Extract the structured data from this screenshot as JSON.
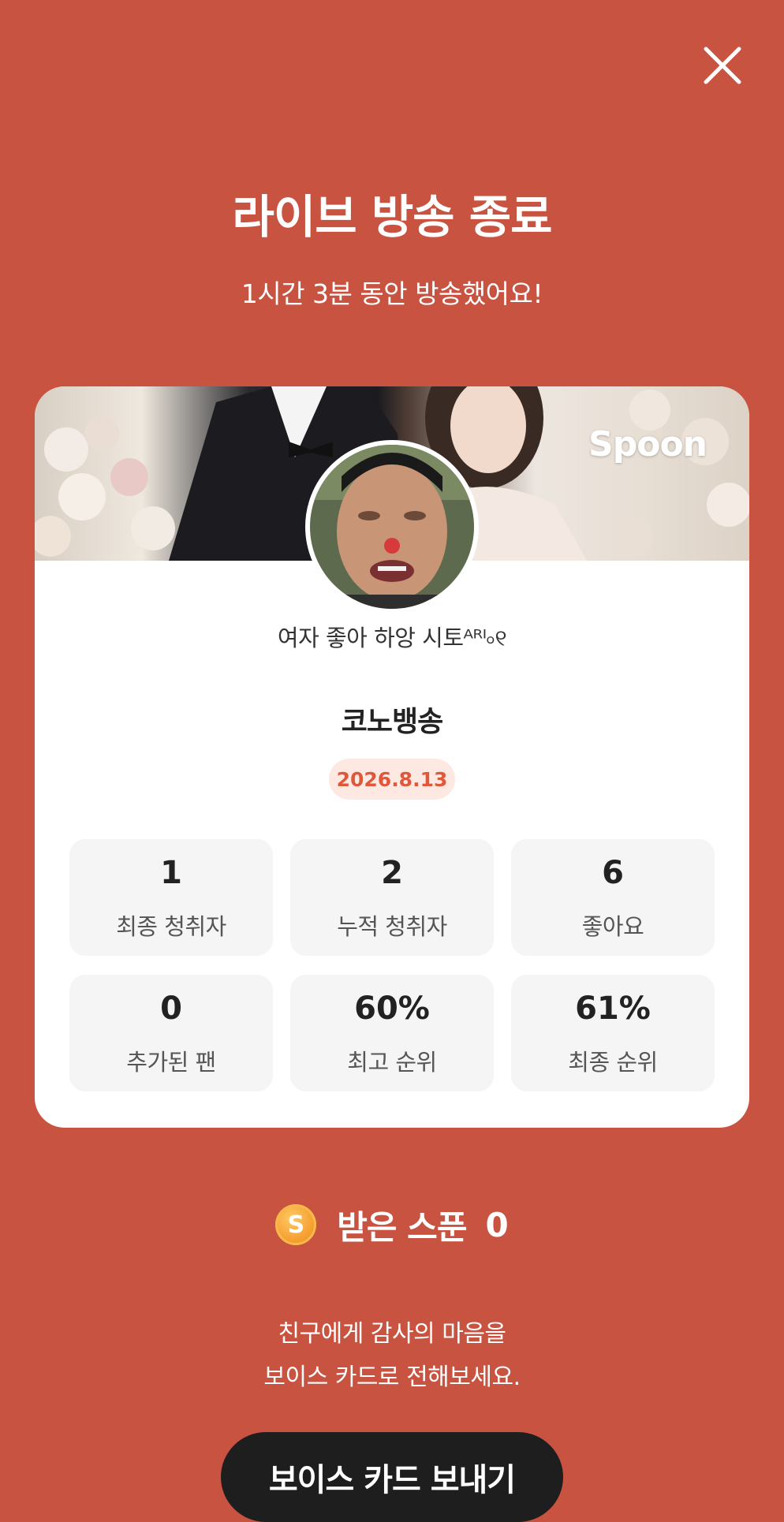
{
  "header": {
    "close_icon": "close-icon",
    "title": "라이브 방송 종료",
    "subtitle": "1시간 3분 동안 방송했어요!"
  },
  "card": {
    "brand": "Spoon",
    "nickname": "여자 좋아 하앙 시토ᴬᴿᴵ৹୧",
    "show_title": "코노뱅송",
    "date": "2026.8.13",
    "stats": [
      {
        "value": "1",
        "label": "최종 청취자"
      },
      {
        "value": "2",
        "label": "누적 청취자"
      },
      {
        "value": "6",
        "label": "좋아요"
      },
      {
        "value": "0",
        "label": "추가된 팬"
      },
      {
        "value": "60%",
        "label": "최고 순위"
      },
      {
        "value": "61%",
        "label": "최종 순위"
      }
    ]
  },
  "spoons": {
    "icon": "spoon-coin-icon",
    "coin_letter": "S",
    "label": "받은 스푼",
    "value": "0"
  },
  "message": {
    "line1": "친구에게 감사의 마음을",
    "line2": "보이스 카드로 전해보세요."
  },
  "cta": {
    "label": "보이스 카드 보내기"
  },
  "colors": {
    "background": "#c85340",
    "badge_text": "#e0583c",
    "badge_bg": "#fde8e2",
    "button_bg": "#1e1e1e"
  }
}
